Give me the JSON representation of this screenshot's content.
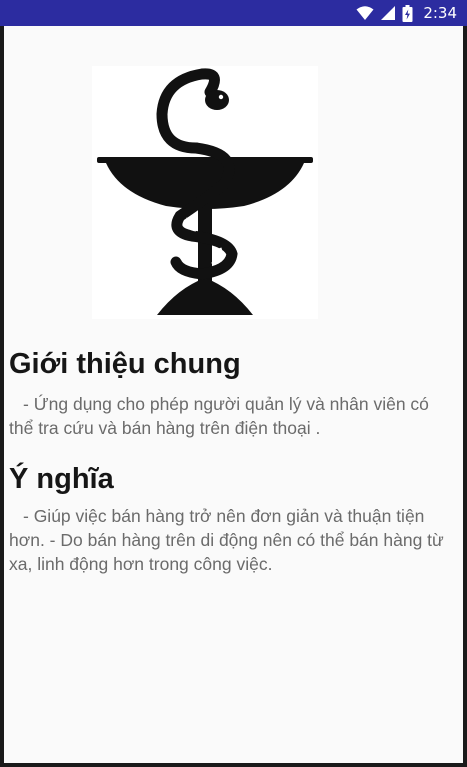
{
  "status_bar": {
    "time": "2:34",
    "icons": [
      "wifi-icon",
      "cell-signal-icon",
      "battery-icon"
    ]
  },
  "sections": [
    {
      "title": "Giới thiệu chung",
      "body": "- Ứng dụng cho phép người quản lý và nhân viên có thể tra cứu và bán hàng trên điện thoại ."
    },
    {
      "title": "Ý nghĩa",
      "body": "- Giúp việc bán hàng trở nên đơn giản và thuận tiện hơn. - Do bán hàng trên di động nên có thể bán hàng từ xa, linh động hơn trong công việc."
    }
  ],
  "logo": {
    "icon": "pharmacy-bowl-of-hygieia-logo"
  },
  "colors": {
    "status_bar": "#2c2ca0",
    "background": "#fafafa",
    "title": "#161616",
    "body_text": "#6b6b6b"
  }
}
